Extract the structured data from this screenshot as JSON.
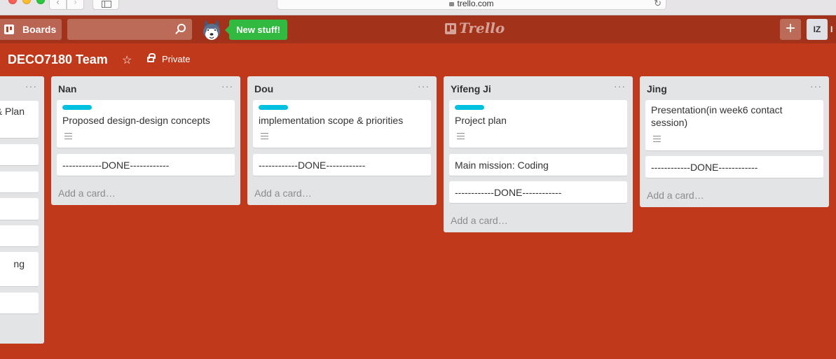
{
  "browser": {
    "url": "trello.com"
  },
  "header": {
    "boards_label": "Boards",
    "new_stuff_label": "New stuff!",
    "brand": "Trello",
    "add_label": "+",
    "avatar_initials": "IZ",
    "avatar_2": "I"
  },
  "board": {
    "title": "DECO7180 Team",
    "star": "☆",
    "privacy": "Private"
  },
  "ghost_list": {
    "menu": "···",
    "cards": [
      "& Plan",
      "",
      "",
      "",
      "",
      "ng",
      ""
    ]
  },
  "lists": [
    {
      "title": "Nan",
      "menu": "···",
      "cards": [
        {
          "text": "Proposed design-design concepts"
        },
        {
          "text": "------------DONE------------"
        }
      ],
      "add_card": "Add a card…"
    },
    {
      "title": "Dou",
      "menu": "···",
      "cards": [
        {
          "text": "implementation scope & priorities"
        },
        {
          "text": "------------DONE------------"
        }
      ],
      "add_card": "Add a card…"
    },
    {
      "title": "Yifeng Ji",
      "menu": "···",
      "cards": [
        {
          "text": "Project plan"
        },
        {
          "text": "Main mission: Coding"
        },
        {
          "text": "------------DONE------------"
        }
      ],
      "add_card": "Add a card…"
    },
    {
      "title": "Jing",
      "menu": "···",
      "cards": [
        {
          "text": "Presentation(in week6 contact session)"
        },
        {
          "text": "------------DONE------------"
        }
      ],
      "add_card": "Add a card…"
    }
  ],
  "colors": {
    "board_bg": "#c0391a",
    "header_bg": "#a3321a",
    "label_cyan": "#00c2e0",
    "new_stuff_green": "#31b940"
  }
}
